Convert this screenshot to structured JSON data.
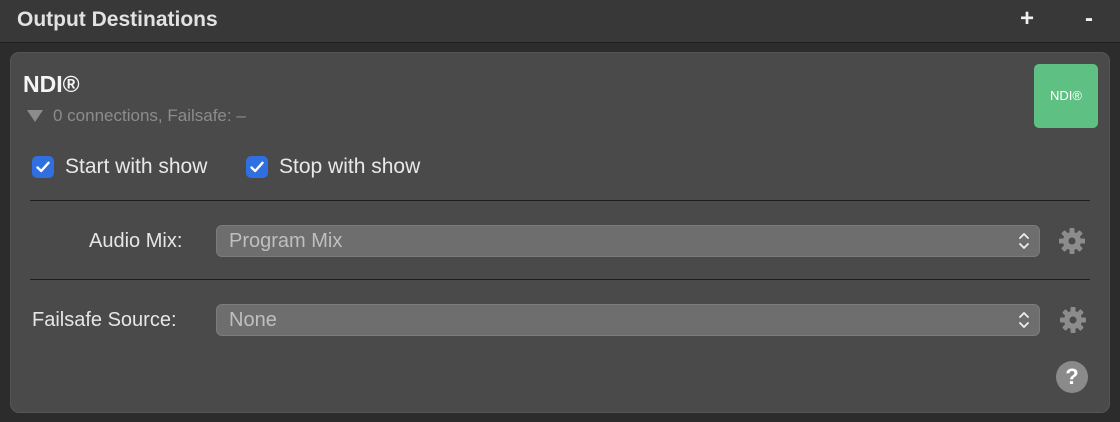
{
  "header": {
    "title": "Output Destinations",
    "add_label": "+",
    "remove_label": "-"
  },
  "destination": {
    "title": "NDI®",
    "status": "0 connections, Failsafe: –",
    "badge_label": "NDI®",
    "badge_color": "#5ec183",
    "start_with_show": {
      "label": "Start with show",
      "checked": true
    },
    "stop_with_show": {
      "label": "Stop with show",
      "checked": true
    },
    "audio_mix": {
      "label": "Audio Mix:",
      "value": "Program Mix"
    },
    "failsafe_source": {
      "label": "Failsafe Source:",
      "value": "None"
    },
    "help_label": "?"
  },
  "colors": {
    "accent_checkbox": "#2f6fe0",
    "panel_bg": "#4a4a4a",
    "window_bg": "#2c2c2c"
  },
  "icons": [
    "triangle-down-icon",
    "checkmark-icon",
    "chevron-updown-icon",
    "gear-icon",
    "question-icon"
  ]
}
